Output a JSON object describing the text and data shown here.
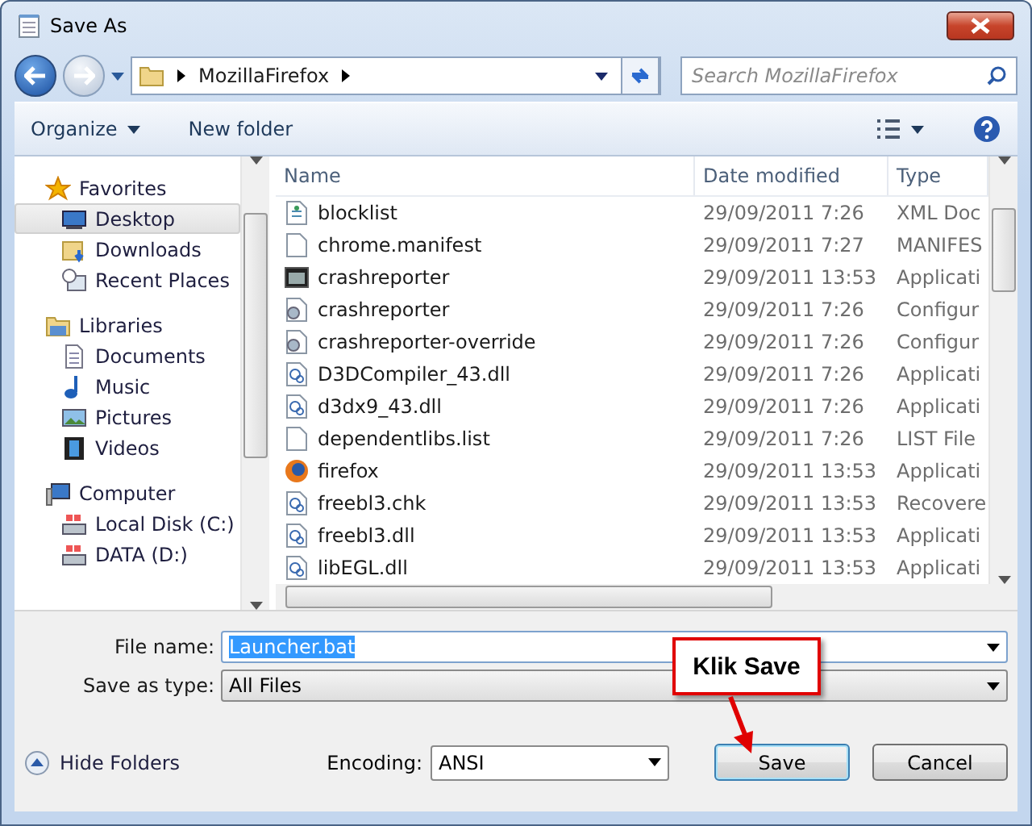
{
  "window": {
    "title": "Save As"
  },
  "address": {
    "path": [
      "MozillaFirefox"
    ],
    "search_placeholder": "Search MozillaFirefox"
  },
  "toolbar": {
    "organize": "Organize",
    "new_folder": "New folder"
  },
  "sidebar": {
    "groups": [
      {
        "label": "Favorites",
        "kind": "star",
        "children": [
          {
            "label": "Desktop",
            "kind": "desktop",
            "selected": true
          },
          {
            "label": "Downloads",
            "kind": "downloads",
            "selected": false
          },
          {
            "label": "Recent Places",
            "kind": "recent",
            "selected": false
          }
        ]
      },
      {
        "label": "Libraries",
        "kind": "library",
        "children": [
          {
            "label": "Documents",
            "kind": "document",
            "selected": false
          },
          {
            "label": "Music",
            "kind": "music",
            "selected": false
          },
          {
            "label": "Pictures",
            "kind": "picture",
            "selected": false
          },
          {
            "label": "Videos",
            "kind": "video",
            "selected": false
          }
        ]
      },
      {
        "label": "Computer",
        "kind": "computer",
        "children": [
          {
            "label": "Local Disk (C:)",
            "kind": "disk",
            "selected": false
          },
          {
            "label": "DATA (D:)",
            "kind": "disk",
            "selected": false
          }
        ]
      }
    ]
  },
  "table": {
    "columns": [
      "Name",
      "Date modified",
      "Type"
    ],
    "rows": [
      {
        "name": "blocklist",
        "kind": "xml",
        "date": "29/09/2011 7:26",
        "type": "XML Doc"
      },
      {
        "name": "chrome.manifest",
        "kind": "blank",
        "date": "29/09/2011 7:27",
        "type": "MANIFES"
      },
      {
        "name": "crashreporter",
        "kind": "app",
        "date": "29/09/2011 13:53",
        "type": "Applicati"
      },
      {
        "name": "crashreporter",
        "kind": "config",
        "date": "29/09/2011 7:26",
        "type": "Configur"
      },
      {
        "name": "crashreporter-override",
        "kind": "config",
        "date": "29/09/2011 7:26",
        "type": "Configur"
      },
      {
        "name": "D3DCompiler_43.dll",
        "kind": "dll",
        "date": "29/09/2011 7:26",
        "type": "Applicati"
      },
      {
        "name": "d3dx9_43.dll",
        "kind": "dll",
        "date": "29/09/2011 7:26",
        "type": "Applicati"
      },
      {
        "name": "dependentlibs.list",
        "kind": "blank",
        "date": "29/09/2011 7:26",
        "type": "LIST File"
      },
      {
        "name": "firefox",
        "kind": "firefox",
        "date": "29/09/2011 13:53",
        "type": "Applicati"
      },
      {
        "name": "freebl3.chk",
        "kind": "dll",
        "date": "29/09/2011 13:53",
        "type": "Recovere"
      },
      {
        "name": "freebl3.dll",
        "kind": "dll",
        "date": "29/09/2011 13:53",
        "type": "Applicati"
      },
      {
        "name": "libEGL.dll",
        "kind": "dll",
        "date": "29/09/2011 13:53",
        "type": "Applicati"
      }
    ]
  },
  "form": {
    "file_name_label": "File name:",
    "file_name": "Launcher.bat",
    "type_label": "Save as type:",
    "type_value": "All Files",
    "hide_folders": "Hide Folders",
    "encoding_label": "Encoding:",
    "encoding": "ANSI",
    "save": "Save",
    "cancel": "Cancel"
  },
  "callout": {
    "text": "Klik Save"
  }
}
